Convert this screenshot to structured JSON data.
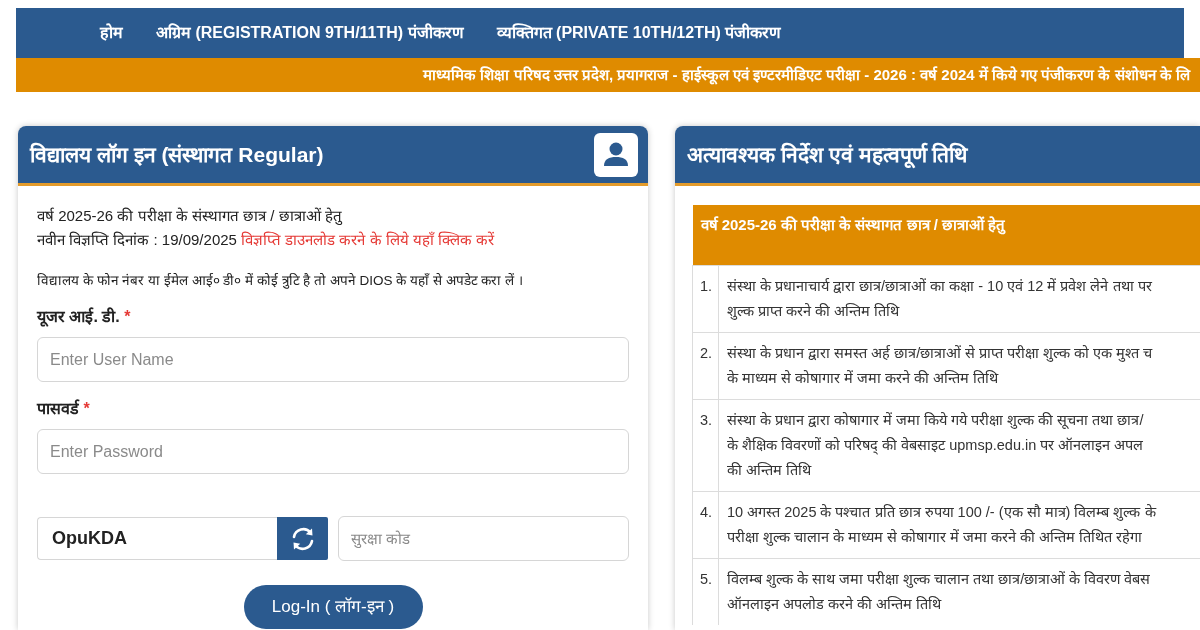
{
  "nav": {
    "items": [
      {
        "label": "होम"
      },
      {
        "label": "अग्रिम (REGISTRATION 9TH/11TH) पंजीकरण"
      },
      {
        "label": "व्यक्तिगत (PRIVATE 10TH/12TH) पंजीकरण"
      }
    ]
  },
  "marquee": {
    "text": "माध्यमिक शिक्षा परिषद उत्तर प्रदेश, प्रयागराज - हाईस्कूल एवं इण्टरमीडिएट परीक्षा - 2026 : वर्ष 2024 में किये गए पंजीकरण के संशोधन के लि"
  },
  "login_panel": {
    "title": "विद्यालय लॉग इन (संस्थागत Regular)",
    "notice": {
      "line_1": "वर्ष 2025-26 की परीक्षा के संस्थागत छात्र / छात्राओं हेतु",
      "line_2": "नवीन विज्ञप्ति दिनांक : 19/09/2025",
      "link": "विज्ञप्ति डाउनलोड करने के लिये यहाँ क्लिक करें"
    },
    "note": "विद्यालय के फोन नंबर या ईमेल आई० डी० में कोई त्रुटि है तो अपने DIOS के यहाँ से अपडेट करा लें ।",
    "fields": [
      {
        "label": "यूजर आई. डी.",
        "required_mark": "*",
        "placeholder": "Enter User Name"
      },
      {
        "label": "पासवर्ड",
        "required_mark": "*",
        "placeholder": "Enter Password"
      }
    ],
    "captcha": {
      "code": "OpuKDA",
      "placeholder": "सुरक्षा कोड"
    },
    "submit": "Log-In ( लॉग-इन )"
  },
  "instructions_panel": {
    "title": "अत्यावश्यक निर्देश एवं महत्वपूर्ण तिथि",
    "table": {
      "heading": "वर्ष 2025-26 की परीक्षा के संस्थागत छात्र / छात्राओं हेतु",
      "rows": [
        {
          "number": "1.",
          "lines": [
            "संस्था के प्रधानाचार्य द्वारा छात्र/छात्राओं का कक्षा - 10 एवं 12 में प्रवेश लेने तथा पर",
            "शुल्क प्राप्त करने की अन्तिम तिथि"
          ]
        },
        {
          "number": "2.",
          "lines": [
            "संस्था के प्रधान द्वारा समस्त अर्ह छात्र/छात्राओं से प्राप्त परीक्षा शुल्क को एक मुश्त च",
            "के माध्यम से कोषागार में जमा करने की अन्तिम तिथि"
          ]
        },
        {
          "number": "3.",
          "lines": [
            "संस्था के प्रधान द्वारा कोषागार में जमा किये गये परीक्षा शुल्क की सूचना तथा छात्र/",
            "के शैक्षिक विवरणों को परिषद् की वेबसाइट upmsp.edu.in पर ऑनलाइन अपल",
            "की अन्तिम तिथि"
          ]
        },
        {
          "number": "4.",
          "lines": [
            "10 अगस्त 2025 के पश्चात प्रति छात्र रुपया 100 /- (एक सौ मात्र) विलम्ब शुल्क के",
            "परीक्षा शुल्क चालान के माध्यम से कोषागार में जमा करने की अन्तिम तिथित रहेगा"
          ]
        },
        {
          "number": "5.",
          "lines": [
            "विलम्ब शुल्क के साथ जमा परीक्षा शुल्क चालान तथा छात्र/छात्राओं के विवरण वेबस",
            "ऑनलाइन अपलोड करने की अन्तिम तिथि"
          ]
        }
      ]
    }
  }
}
